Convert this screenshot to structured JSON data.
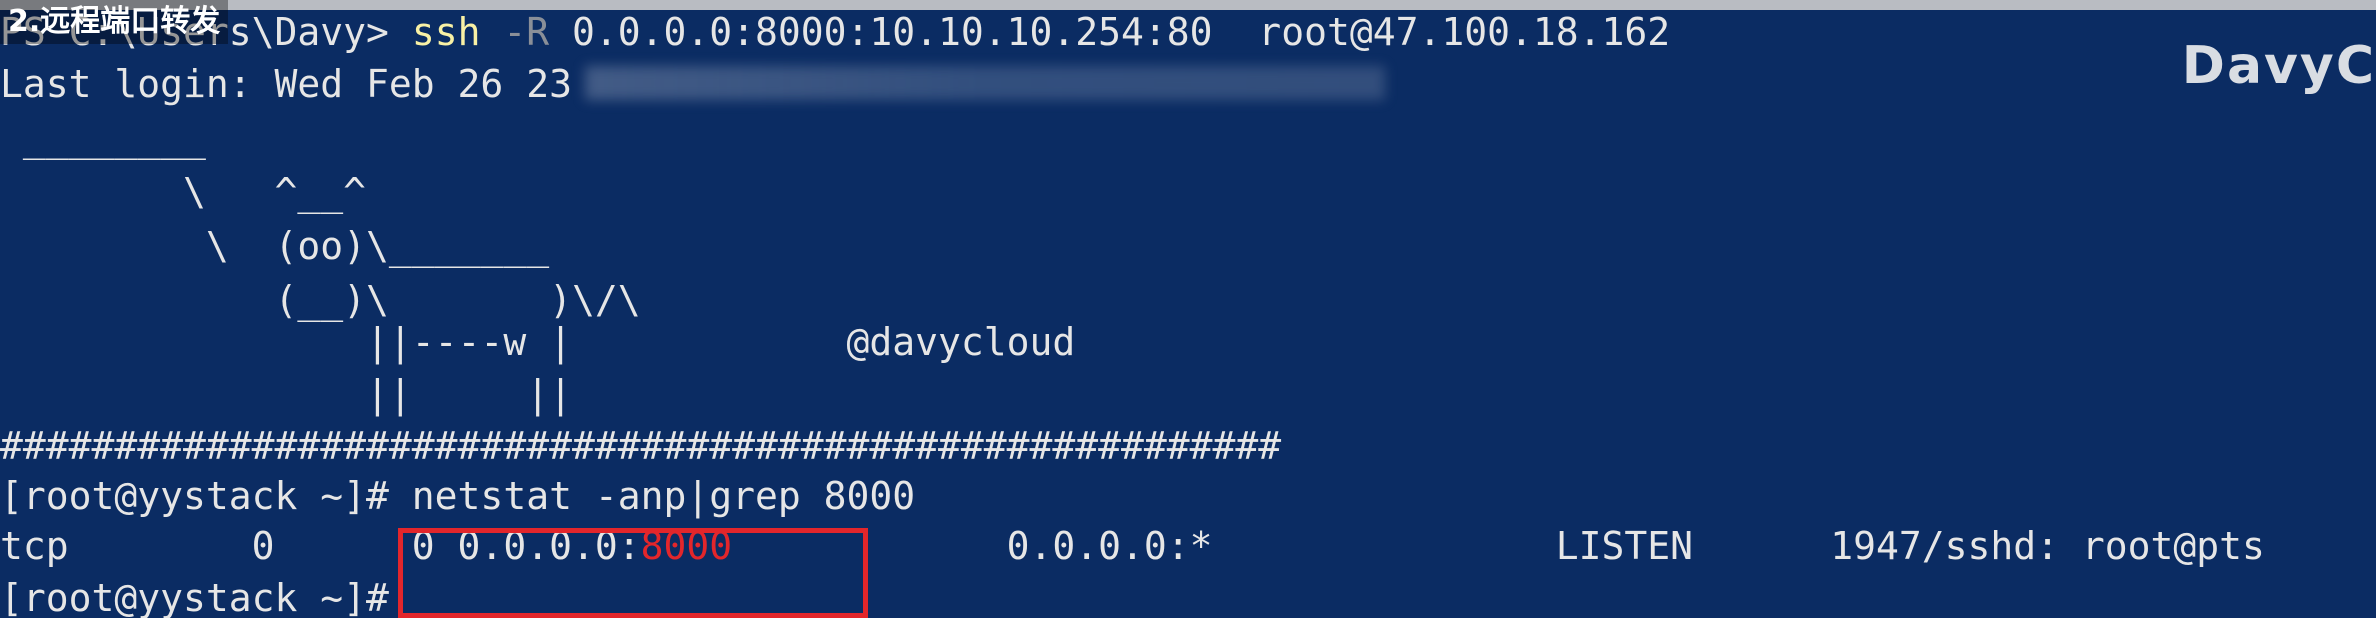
{
  "overlay": {
    "title": "2.远程端口转发"
  },
  "watermark": "DavyC",
  "colors": {
    "terminal_bg": "#0b2c63",
    "command_yellow": "#f9f1a5",
    "arg_gray": "#8a8f98",
    "highlight_red": "#e3262b"
  },
  "lines": {
    "l1_prompt": "PS C:\\Users\\Davy> ",
    "l1_cmd": "ssh",
    "l1_flag": " -R",
    "l1_args": " 0.0.0.0:8000:10.10.10.254:80  root@47.100.18.162",
    "l2": "Last login: Wed Feb 26 23",
    "l3": " ________",
    "l4": "        \\   ^__^",
    "l5": "         \\  (oo)\\_______",
    "l6": "            (__)\\       )\\/\\",
    "l7": "                ||----w |            @davycloud",
    "l8": "                ||     ||",
    "l9": "########################################################",
    "l10": "[root@yystack ~]# netstat -anp|grep 8000",
    "l11_a": "tcp        0      0 0.0.0.0:",
    "l11_port": "8000",
    "l11_b": "            0.0.0.0:*               LISTEN      1947/sshd: root@pts",
    "l12": "[root@yystack ~]#"
  }
}
